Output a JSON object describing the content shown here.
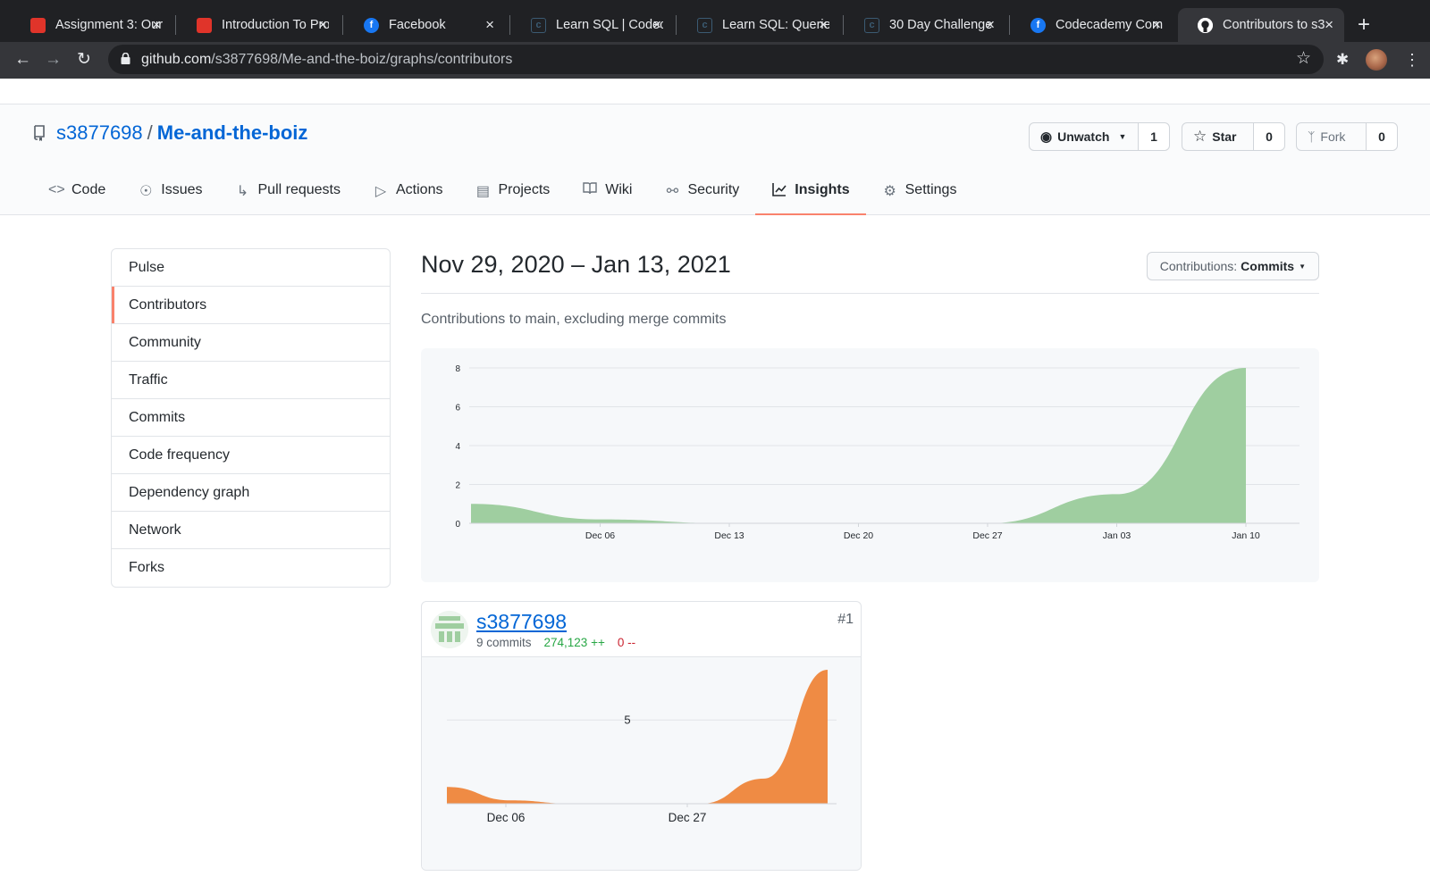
{
  "browser": {
    "tabs": [
      {
        "title": "Assignment 3: Our",
        "favicon": "red-square-icon"
      },
      {
        "title": "Introduction To Pro",
        "favicon": "red-square-icon"
      },
      {
        "title": "Facebook",
        "favicon": "facebook-icon"
      },
      {
        "title": "Learn SQL | Codec",
        "favicon": "codecademy-icon"
      },
      {
        "title": "Learn SQL: Querie",
        "favicon": "codecademy-icon"
      },
      {
        "title": "30 Day Challenge",
        "favicon": "codecademy-icon"
      },
      {
        "title": "Codecademy Com",
        "favicon": "facebook-icon"
      },
      {
        "title": "Contributors to s3",
        "favicon": "github-icon",
        "active": true
      }
    ],
    "url_host": "github.com",
    "url_path": "/s3877698/Me-and-the-boiz/graphs/contributors"
  },
  "repo": {
    "owner": "s3877698",
    "separator": "/",
    "name": "Me-and-the-boiz",
    "watch_label": "Unwatch",
    "watch_count": "1",
    "star_label": "Star",
    "star_count": "0",
    "fork_label": "Fork",
    "fork_count": "0"
  },
  "nav": [
    {
      "label": "Code",
      "icon": "code-icon"
    },
    {
      "label": "Issues",
      "icon": "issue-icon"
    },
    {
      "label": "Pull requests",
      "icon": "pull-request-icon"
    },
    {
      "label": "Actions",
      "icon": "play-icon"
    },
    {
      "label": "Projects",
      "icon": "project-icon"
    },
    {
      "label": "Wiki",
      "icon": "book-icon"
    },
    {
      "label": "Security",
      "icon": "shield-icon"
    },
    {
      "label": "Insights",
      "icon": "graph-icon",
      "selected": true
    },
    {
      "label": "Settings",
      "icon": "gear-icon"
    }
  ],
  "sidebar": [
    {
      "label": "Pulse"
    },
    {
      "label": "Contributors",
      "selected": true
    },
    {
      "label": "Community"
    },
    {
      "label": "Traffic"
    },
    {
      "label": "Commits"
    },
    {
      "label": "Code frequency"
    },
    {
      "label": "Dependency graph"
    },
    {
      "label": "Network"
    },
    {
      "label": "Forks"
    }
  ],
  "main": {
    "date_range": "Nov 29, 2020 – Jan 13, 2021",
    "contributions_prefix": "Contributions:",
    "contributions_value": "Commits",
    "subtitle": "Contributions to main, excluding merge commits"
  },
  "contributor": {
    "name": "s3877698",
    "commits": "9 commits",
    "additions": "274,123 ++",
    "deletions": "0 --",
    "rank": "#1"
  },
  "colors": {
    "accent": "#f9826c",
    "link": "#0366d6",
    "big_area": "#9fcea0",
    "small_area": "#ef8b44"
  },
  "chart_data": [
    {
      "type": "area",
      "title": "",
      "x": [
        "Nov 29",
        "Dec 06",
        "Dec 13",
        "Dec 20",
        "Dec 27",
        "Jan 03",
        "Jan 10"
      ],
      "x_ticks": [
        "Dec 06",
        "Dec 13",
        "Dec 20",
        "Dec 27",
        "Jan 03",
        "Jan 10"
      ],
      "series": [
        {
          "values": [
            1,
            0.2,
            0,
            0,
            0,
            1.5,
            8
          ]
        }
      ],
      "y_ticks": [
        "0",
        "2",
        "4",
        "6",
        "8"
      ],
      "ylim": [
        0,
        8
      ],
      "grid": true
    },
    {
      "type": "area",
      "title": "",
      "x": [
        "Nov 29",
        "Dec 06",
        "Dec 13",
        "Dec 20",
        "Dec 27",
        "Jan 03",
        "Jan 10"
      ],
      "x_ticks": [
        "Dec 06",
        "Dec 27"
      ],
      "series": [
        {
          "values": [
            1,
            0.2,
            0,
            0,
            0,
            1.5,
            8
          ]
        }
      ],
      "y_ticks": [
        "5"
      ],
      "ylim": [
        0,
        8
      ],
      "grid": true
    }
  ]
}
